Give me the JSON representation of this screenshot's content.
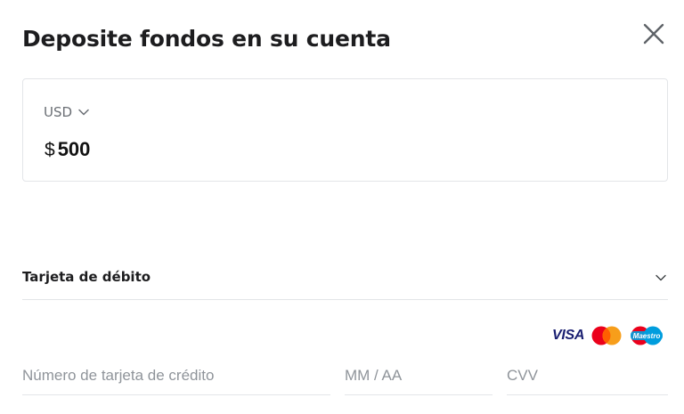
{
  "dialog": {
    "title": "Deposite fondos en su cuenta",
    "close_icon": "close-icon"
  },
  "amount_card": {
    "currency_code": "USD",
    "currency_symbol": "$",
    "amount_value": "500"
  },
  "payment_method": {
    "label": "Tarjeta de débito",
    "expand_icon": "chevron-down-icon"
  },
  "card_logos": {
    "visa": "VISA",
    "maestro": "Maestro",
    "colors": {
      "visa_blue": "#1a1f71",
      "mastercard_red": "#eb001b",
      "mastercard_orange": "#f79e1b",
      "maestro_blue": "#009ddd"
    }
  },
  "card_form": {
    "card_number_placeholder": "Número de tarjeta de crédito",
    "expiry_placeholder": "MM / AA",
    "cvv_placeholder": "CVV"
  }
}
